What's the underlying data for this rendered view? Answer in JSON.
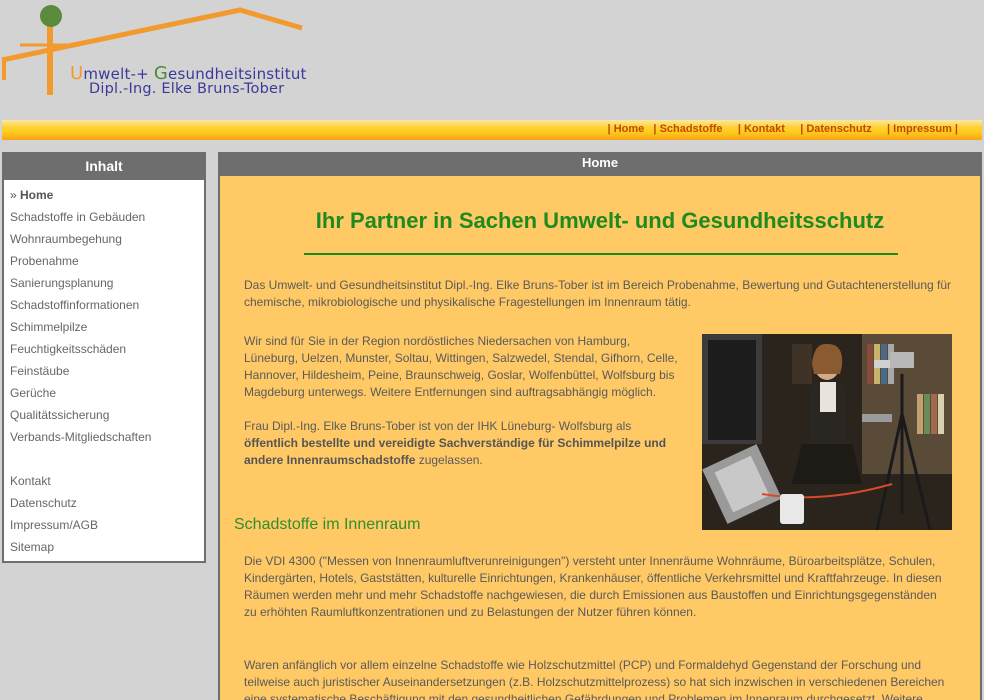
{
  "logo": {
    "line1_u": "U",
    "line1_a": "mwelt-+ ",
    "line1_g": "G",
    "line1_b": "esundheitsinstitut",
    "line2": "Dipl.-Ing. Elke Bruns-Tober"
  },
  "topnav": {
    "items": [
      "Home",
      "Schadstoffe",
      "Kontakt",
      "Datenschutz",
      "Impressum"
    ]
  },
  "sidebar": {
    "title": "Inhalt",
    "active_marker": "» ",
    "items": [
      "Home",
      "Schadstoffe in Gebäuden",
      "Wohnraumbegehung",
      "Probenahme",
      "Sanierungsplanung",
      "Schadstoffinformationen",
      "Schimmelpilze",
      "Feuchtigkeitsschäden",
      "Feinstäube",
      "Gerüche",
      "Qualitätssicherung",
      "Verbands-Mitgliedschaften"
    ],
    "items2": [
      "Kontakt",
      "Datenschutz",
      "Impressum/AGB",
      "Sitemap"
    ]
  },
  "main": {
    "header": "Home",
    "headline": "Ihr Partner in Sachen Umwelt- und Gesundheitsschutz",
    "intro": "Das Umwelt- und Gesundheitsinstitut Dipl.-Ing. Elke Bruns-Tober ist im Bereich Probenahme, Bewertung und Gutachtenerstellung für chemische, mikrobiologische und physikalische Fragestellungen im Innenraum tätig.",
    "region": "Wir sind für Sie in der Region nordöstliches Niedersachen von Hamburg, Lüneburg, Uelzen, Munster, Soltau, Wittingen, Salzwedel, Stendal, Gifhorn, Celle, Hannover, Hildesheim, Peine, Braunschweig, Goslar, Wolfenbüttel, Wolfsburg bis Magdeburg unterwegs. Weitere Entfernungen sind auftragsabhängig möglich.",
    "expert_pre": "Frau Dipl.-Ing. Elke Bruns-Tober ist von der IHK Lüneburg- Wolfsburg als ",
    "expert_bold": "öffentlich bestellte und vereidigte Sachverständige für Schimmelpilze und andere Innenraumschadstoffe",
    "expert_post": " zugelassen.",
    "subheading": "Schadstoffe im Innenraum",
    "vdi": "Die VDI 4300 (\"Messen von Innenraumluftverunreinigungen\") versteht unter Innenräume Wohnräume, Büroarbeitsplätze, Schulen, Kindergärten, Hotels, Gaststätten, kulturelle Einrichtungen, Krankenhäuser, öffentliche Verkehrsmittel und Kraftfahrzeuge. In diesen Räumen werden mehr und mehr Schadstoffe nachgewiesen, die durch Emissionen aus Baustoffen und Einrichtungsgegenständen zu erhöhten Raumluftkonzentrationen und zu Belastungen der Nutzer führen können.",
    "history": "Waren anfänglich vor allem einzelne Schadstoffe wie Holzschutzmittel (PCP) und Formaldehyd Gegenstand der Forschung und teilweise auch juristischer Auseinandersetzungen (z.B. Holzschutzmittelprozess) so hat sich inzwischen in verschiedenen Bereichen eine systematische Beschäftigung mit den gesundheitlichen Gefährdungen und Problemen im Innenraum durchgesetzt. Weitere"
  },
  "colors": {
    "accent_green": "#1f8a1f",
    "nav_text": "#c24a00",
    "content_bg": "#ffc965",
    "frame_gray": "#6e6e6e"
  }
}
